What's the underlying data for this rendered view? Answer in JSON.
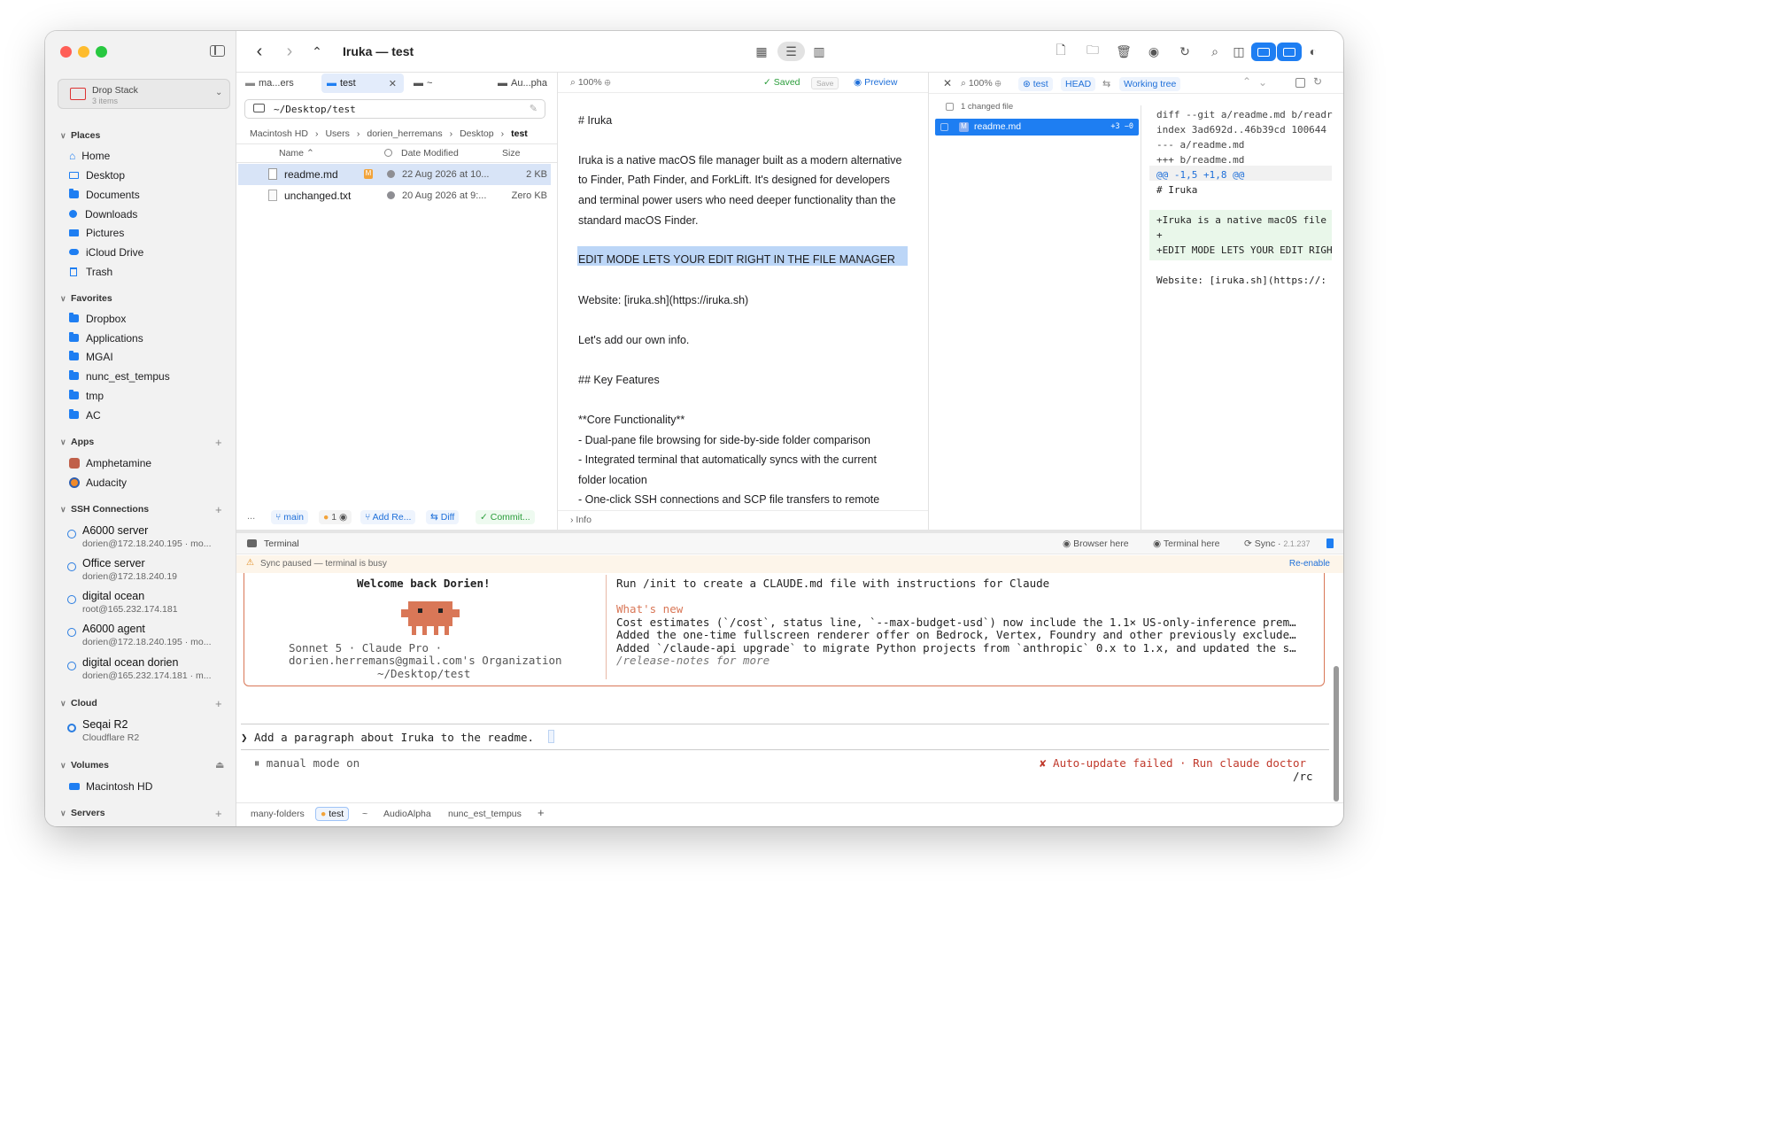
{
  "window": {
    "title": "Iruka — test"
  },
  "sidebar": {
    "dropstack": {
      "title": "Drop Stack",
      "count": "3 items"
    },
    "places": {
      "label": "Places",
      "items": [
        "Home",
        "Desktop",
        "Documents",
        "Downloads",
        "Pictures",
        "iCloud Drive",
        "Trash"
      ]
    },
    "favorites": {
      "label": "Favorites",
      "items": [
        "Dropbox",
        "Applications",
        "MGAI",
        "nunc_est_tempus",
        "tmp",
        "AC"
      ]
    },
    "apps": {
      "label": "Apps",
      "items": [
        "Amphetamine",
        "Audacity"
      ]
    },
    "ssh": {
      "label": "SSH Connections",
      "items": [
        {
          "name": "A6000 server",
          "sub": "dorien@172.18.240.195 · mo..."
        },
        {
          "name": "Office server",
          "sub": "dorien@172.18.240.19"
        },
        {
          "name": "digital ocean",
          "sub": "root@165.232.174.181"
        },
        {
          "name": "A6000 agent",
          "sub": "dorien@172.18.240.195 · mo..."
        },
        {
          "name": "digital ocean dorien",
          "sub": "dorien@165.232.174.181 · m..."
        }
      ]
    },
    "cloud": {
      "label": "Cloud",
      "items": [
        {
          "name": "Seqai R2",
          "sub": "Cloudflare R2"
        }
      ]
    },
    "volumes": {
      "label": "Volumes",
      "items": [
        "Macintosh HD"
      ]
    },
    "servers": {
      "label": "Servers"
    }
  },
  "browser": {
    "tabs": [
      "ma...ers",
      "test",
      "~",
      "Au...pha"
    ],
    "path": "~/Desktop/test",
    "breadcrumb": [
      "Macintosh HD",
      "Users",
      "dorien_herremans",
      "Desktop",
      "test"
    ],
    "columns": {
      "name": "Name",
      "date": "Date Modified",
      "size": "Size"
    },
    "files": [
      {
        "name": "readme.md",
        "badge": "M",
        "date": "22 Aug 2026 at 10...",
        "size": "2 KB"
      },
      {
        "name": "unchanged.txt",
        "badge": "",
        "date": "20 Aug 2026 at 9:...",
        "size": "Zero KB"
      }
    ],
    "footer": {
      "more": "...",
      "branch": "main",
      "count": "1",
      "add_repo": "Add Re...",
      "diff": "Diff",
      "commit": "Commit..."
    }
  },
  "editor": {
    "zoom": "100%",
    "saved": "Saved",
    "save": "Save",
    "preview": "Preview",
    "lines": [
      "# Iruka",
      "Iruka is a native macOS file manager built as a modern alternative",
      "to Finder, Path Finder, and ForkLift. It's designed for developers",
      "and terminal power users who need deeper functionality than the",
      "standard macOS Finder.",
      "EDIT MODE LETS YOUR EDIT RIGHT IN THE FILE MANAGER",
      "Website: [iruka.sh](https://iruka.sh)",
      "Let's add our own info.",
      "## Key Features",
      "**Core Functionality**",
      "- Dual-pane file browsing for side-by-side folder comparison",
      "- Integrated terminal that automatically syncs with the current",
      "folder location",
      "- One-click SSH connections and SCP file transfers to remote"
    ],
    "info": "Info"
  },
  "git": {
    "zoom": "100%",
    "branch": "test",
    "head": "HEAD",
    "working_tree": "Working tree",
    "changed": "1 changed file",
    "file": {
      "badge": "M",
      "name": "readme.md",
      "stat": "+3 −0"
    },
    "diff_lines": [
      "diff --git a/readme.md b/readr",
      "index 3ad692d..46b39cd 100644",
      "--- a/readme.md",
      "+++ b/readme.md",
      "@@ -1,5 +1,8 @@",
      " # Iruka",
      "+Iruka is a native macOS file",
      "+",
      "+EDIT MODE LETS YOUR EDIT RIGH",
      " Website: [iruka.sh](https://:"
    ]
  },
  "terminal": {
    "title": "Terminal",
    "browser_here": "Browser here",
    "terminal_here": "Terminal here",
    "sync": "Sync",
    "version": "2.1.237",
    "warning": "Sync paused — terminal is busy",
    "reenable": "Re-enable",
    "welcome": "Welcome back Dorien!",
    "model": "Sonnet 5 · Claude Pro ·",
    "org": "dorien.herremans@gmail.com's Organization",
    "cwd": "~/Desktop/test",
    "init_hint": "Run /init to create a CLAUDE.md file with instructions for Claude",
    "whats_new": "What's new",
    "news": [
      "Cost estimates (`/cost`, status line, `--max-budget-usd`) now include the 1.1× US-only-inference prem…",
      "Added the one-time fullscreen renderer offer on Bedrock, Vertex, Foundry and other previously exclude…",
      "Added `/claude-api upgrade` to migrate Python projects from `anthropic` 0.x to 1.x, and updated the s…",
      "/release-notes for more"
    ],
    "prompt": "Add a paragraph about Iruka to the readme.",
    "mode": "manual mode on",
    "error": "✘ Auto-update failed · Run claude doctor",
    "rc": "/rc"
  },
  "bottom_tabs": [
    "many-folders",
    "test",
    "~",
    "AudioAlpha",
    "nunc_est_tempus",
    "+"
  ]
}
